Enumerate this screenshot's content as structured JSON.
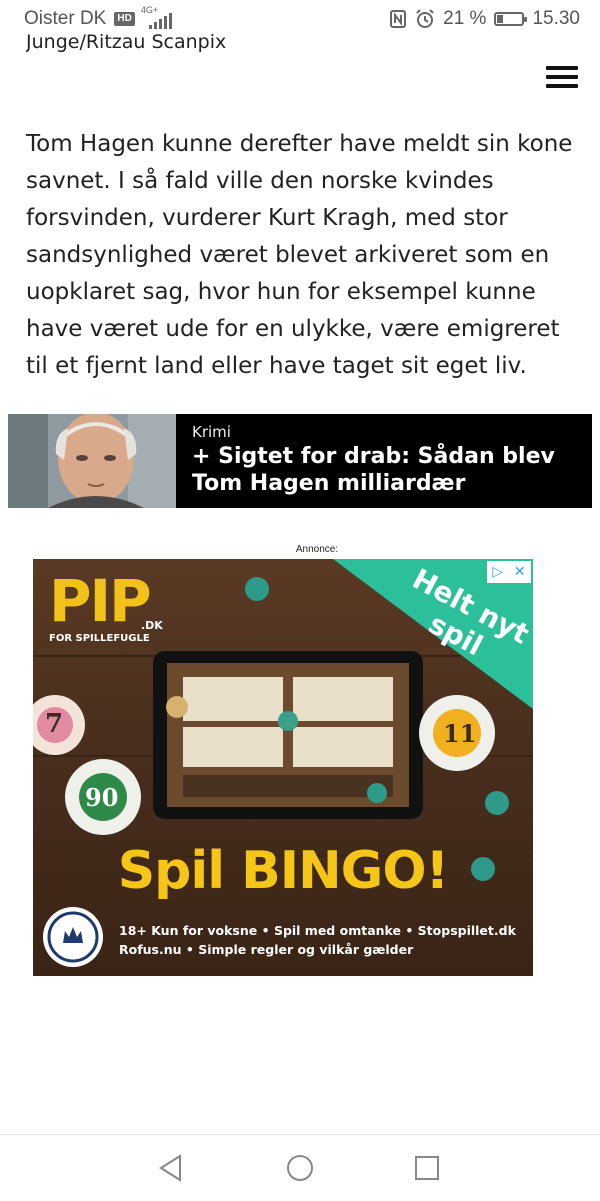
{
  "status_bar": {
    "carrier": "Oister DK",
    "hd": "HD",
    "network": "4G+",
    "battery_percent": "21 %",
    "time": "15.30",
    "battery_level": 0.21
  },
  "article": {
    "photo_credit": "Junge/Ritzau Scanpix",
    "paragraph": "Tom Hagen kunne derefter have meldt sin kone savnet. I så fald ville den norske kvindes forsvinden, vurderer Kurt Kragh, med stor sandsynlighed været blevet arkiveret som en uopklaret sag, hvor hun for eksempel kunne have været ude for en ulykke, være emigreret til et fjernt land eller have taget sit eget liv."
  },
  "teaser": {
    "kicker": "Krimi",
    "title": "+ Sigtet for drab: Sådan blev Tom Hagen milliardær"
  },
  "ad": {
    "label": "Annonce:",
    "logo": "PIP",
    "logo_suffix": ".DK",
    "logo_tagline": "FOR SPILLEFUGLE",
    "corner_banner": "Helt nyt spil",
    "headline": "Spil BINGO!",
    "disclaimer_line1": "18+ Kun for voksne • Spil med omtanke • Stopspillet.dk",
    "disclaimer_line2": "Rofus.nu • Simple regler og vilkår gælder",
    "ball_numbers": [
      "7",
      "90",
      "11"
    ],
    "colors": {
      "background": "#4a2f1e",
      "accent": "#f5c518",
      "banner": "#2bbf9a"
    }
  },
  "icons": {
    "menu": "hamburger-menu-icon",
    "back": "back-triangle-icon",
    "home": "home-circle-icon",
    "recents": "recents-square-icon"
  }
}
